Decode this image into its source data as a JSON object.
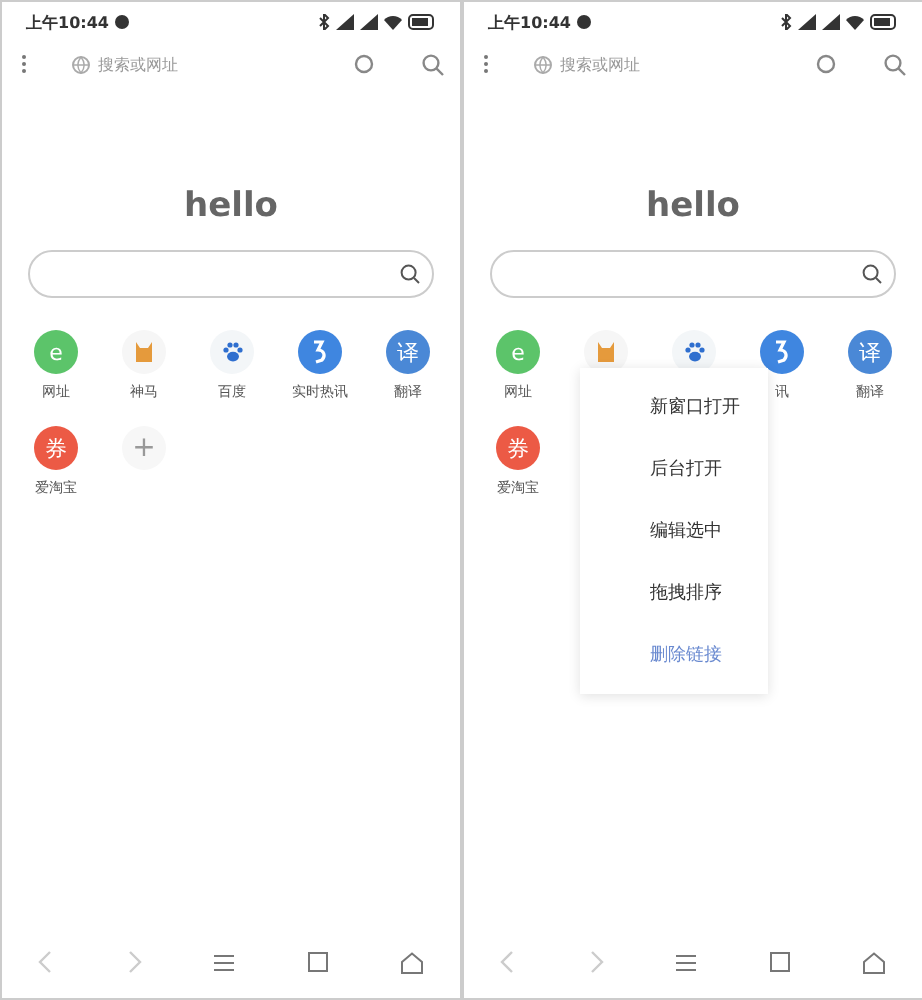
{
  "phones": [
    {
      "time": "上午10:44",
      "search_placeholder": "搜索或网址",
      "logo": "hello",
      "shortcuts": [
        {
          "kind": "letter",
          "glyph": "e",
          "color": "#5cc46a",
          "label": "网址"
        },
        {
          "kind": "dog",
          "label": "神马"
        },
        {
          "kind": "paw",
          "label": "百度"
        },
        {
          "kind": "arrow",
          "color": "#3f86e0",
          "label": "实时热讯"
        },
        {
          "kind": "letter",
          "glyph": "译",
          "color": "#4a88d6",
          "label": "翻译"
        },
        {
          "kind": "letter",
          "glyph": "券",
          "color": "#ec5a45",
          "label": "爱淘宝"
        },
        {
          "kind": "add",
          "glyph": "+"
        }
      ]
    },
    {
      "time": "上午10:44",
      "search_placeholder": "搜索或网址",
      "logo": "hello",
      "shortcuts": [
        {
          "kind": "letter",
          "glyph": "e",
          "color": "#5cc46a",
          "label": "网址"
        },
        {
          "kind": "dog"
        },
        {
          "kind": "paw"
        },
        {
          "kind": "arrow",
          "color": "#3f86e0",
          "label": "讯"
        },
        {
          "kind": "letter",
          "glyph": "译",
          "color": "#4a88d6",
          "label": "翻译"
        },
        {
          "kind": "letter",
          "glyph": "券",
          "color": "#ec5a45",
          "label": "爱淘宝"
        }
      ],
      "menu": [
        {
          "label": "新窗口打开",
          "kind": "normal"
        },
        {
          "label": "后台打开",
          "kind": "normal"
        },
        {
          "label": "编辑选中",
          "kind": "normal"
        },
        {
          "label": "拖拽排序",
          "kind": "normal"
        },
        {
          "label": "删除链接",
          "kind": "accent"
        }
      ]
    }
  ]
}
